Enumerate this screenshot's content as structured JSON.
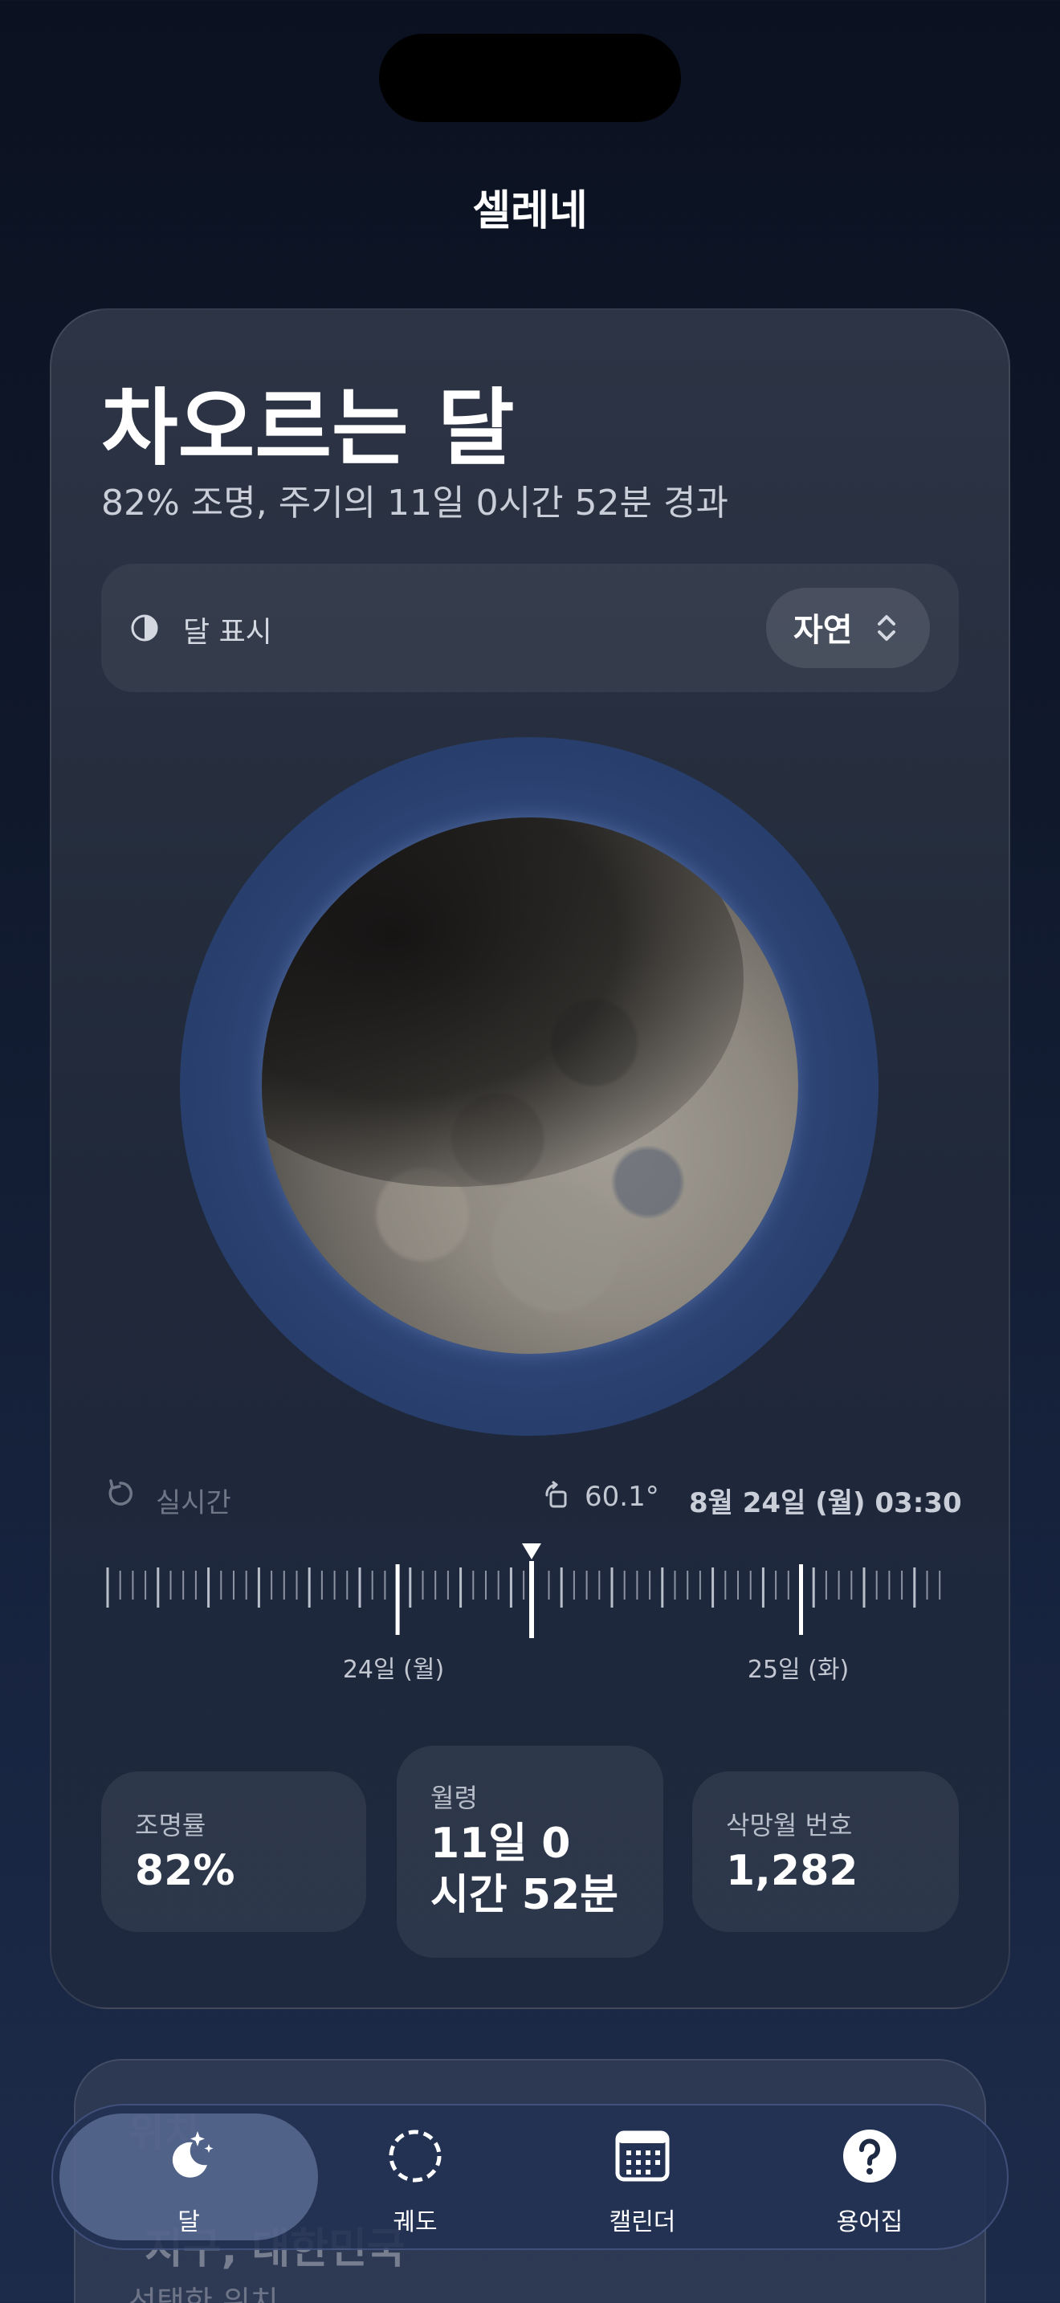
{
  "app": {
    "title": "셀레네"
  },
  "phase": {
    "name": "차오르는 달",
    "subtitle": "82% 조명, 주기의 11일 0시간 52분 경과"
  },
  "display": {
    "label": "달 표시",
    "value": "자연",
    "icon": "half-circle-icon"
  },
  "timeline": {
    "live_label": "실시간",
    "angle": "60.1°",
    "datetime": "8월 24일 (월) 03:30",
    "day_labels": [
      "24일 (월)",
      "25일 (화)"
    ]
  },
  "stats": {
    "illumination": {
      "label": "조명률",
      "value": "82%"
    },
    "age": {
      "label": "월령",
      "line1": "11일 0",
      "line2": "시간 52분"
    },
    "lunation": {
      "label": "삭망월 번호",
      "value": "1,282"
    }
  },
  "second_card": {
    "heading": "위치",
    "line": "지구, 대한민국",
    "hint": "선택한 위치"
  },
  "tabs": [
    {
      "label": "달",
      "icon": "moon-stars-icon",
      "active": true
    },
    {
      "label": "궤도",
      "icon": "dashed-circle-icon",
      "active": false
    },
    {
      "label": "캘린더",
      "icon": "calendar-icon",
      "active": false
    },
    {
      "label": "용어집",
      "icon": "question-icon",
      "active": false
    }
  ],
  "colors": {
    "background_top": "#0b1120",
    "background_bottom": "#1d2b4a",
    "halo": "#2c4373",
    "accent_text": "#ffffff"
  }
}
